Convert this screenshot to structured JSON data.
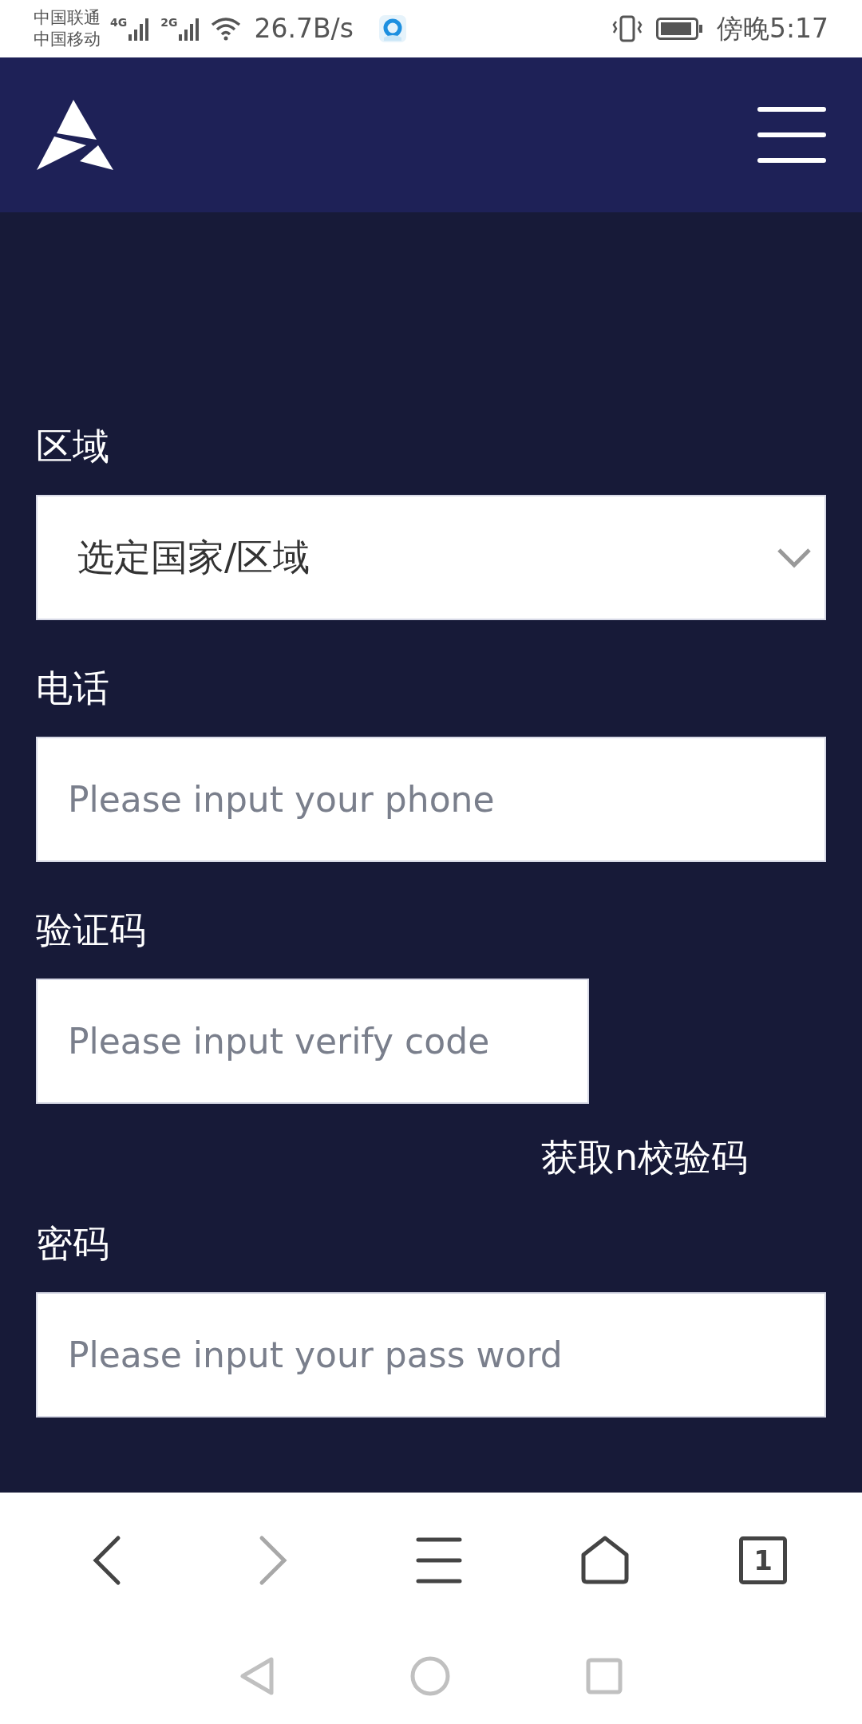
{
  "status_bar": {
    "carriers": [
      "中国联通",
      "中国移动"
    ],
    "signals": [
      "4G",
      "2G"
    ],
    "network_speed": "26.7B/s",
    "time": "傍晚5:17"
  },
  "form": {
    "fields": [
      {
        "kind": "select",
        "label": "区域",
        "value": "选定国家/区域"
      },
      {
        "kind": "input",
        "label": "电话",
        "placeholder": "Please input your phone"
      },
      {
        "kind": "code",
        "label": "验证码",
        "placeholder": "Please input verify code",
        "action": "获取n校验码"
      },
      {
        "kind": "input",
        "label": "密码",
        "placeholder": "Please input your pass word"
      }
    ]
  },
  "browser_toolbar": {
    "back_disabled": false,
    "forward_disabled": true,
    "tab_count": "1"
  }
}
